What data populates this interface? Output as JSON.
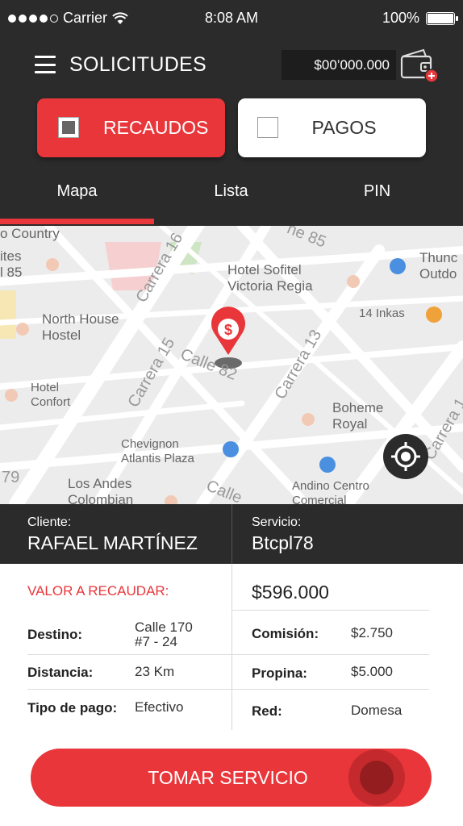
{
  "status_bar": {
    "carrier": "Carrier",
    "time": "8:08 AM",
    "battery": "100%",
    "battery_level": 1.0
  },
  "header": {
    "title": "SOLICITUDES",
    "balance": "$00’000.000"
  },
  "toggle": {
    "recaudos": "RECAUDOS",
    "pagos": "PAGOS",
    "recaudos_checked": true,
    "pagos_checked": false
  },
  "tabs": [
    {
      "label": "Mapa",
      "active": true
    },
    {
      "label": "Lista",
      "active": false
    },
    {
      "label": "PIN",
      "active": false
    }
  ],
  "map": {
    "labels": {
      "country": "o Country",
      "suites": "ites\nl 85",
      "north_house": "North House\nHostel",
      "hotel_confort": "Hotel\nConfort",
      "hotel_sofitel": "Hotel Sofitel\nVictoria Regia",
      "thunder": "Thunc\nOutdo",
      "inkas": "14 Inkas",
      "boheme": "Boheme\nRoyal",
      "chevignon": "Chevignon\nAtlantis Plaza",
      "los_andes": "Los Andes\nColombian",
      "andino": "Andino Centro\nComercial",
      "carrera16": "Carrera 16",
      "carrera15": "Carrera 15",
      "carrera13": "Carrera 13",
      "calle82": "Calle 82",
      "calle85": "ne 85",
      "carrera_right": "Carrera 1",
      "calle_bottom": "Calle",
      "num79": "79"
    },
    "pin_symbol": "$"
  },
  "client": {
    "label": "Cliente:",
    "name": "RAFAEL MARTÍNEZ"
  },
  "service": {
    "label": "Servicio:",
    "code": "Btcpl78"
  },
  "details": {
    "valor_label": "VALOR A RECAUDAR:",
    "valor": "$596.000",
    "destino_label": "Destino:",
    "destino": "Calle 170\n#7 - 24",
    "distancia_label": "Distancia:",
    "distancia": "23 Km",
    "tipo_label": "Tipo de pago:",
    "tipo": "Efectivo",
    "comision_label": "Comisión:",
    "comision": "$2.750",
    "propina_label": "Propina:",
    "propina": "$5.000",
    "red_label": "Red:",
    "red": "Domesa"
  },
  "cta": {
    "label": "TOMAR SERVICIO"
  },
  "colors": {
    "accent": "#e8363a",
    "dark": "#2b2b2b",
    "map_bg": "#ececec"
  }
}
